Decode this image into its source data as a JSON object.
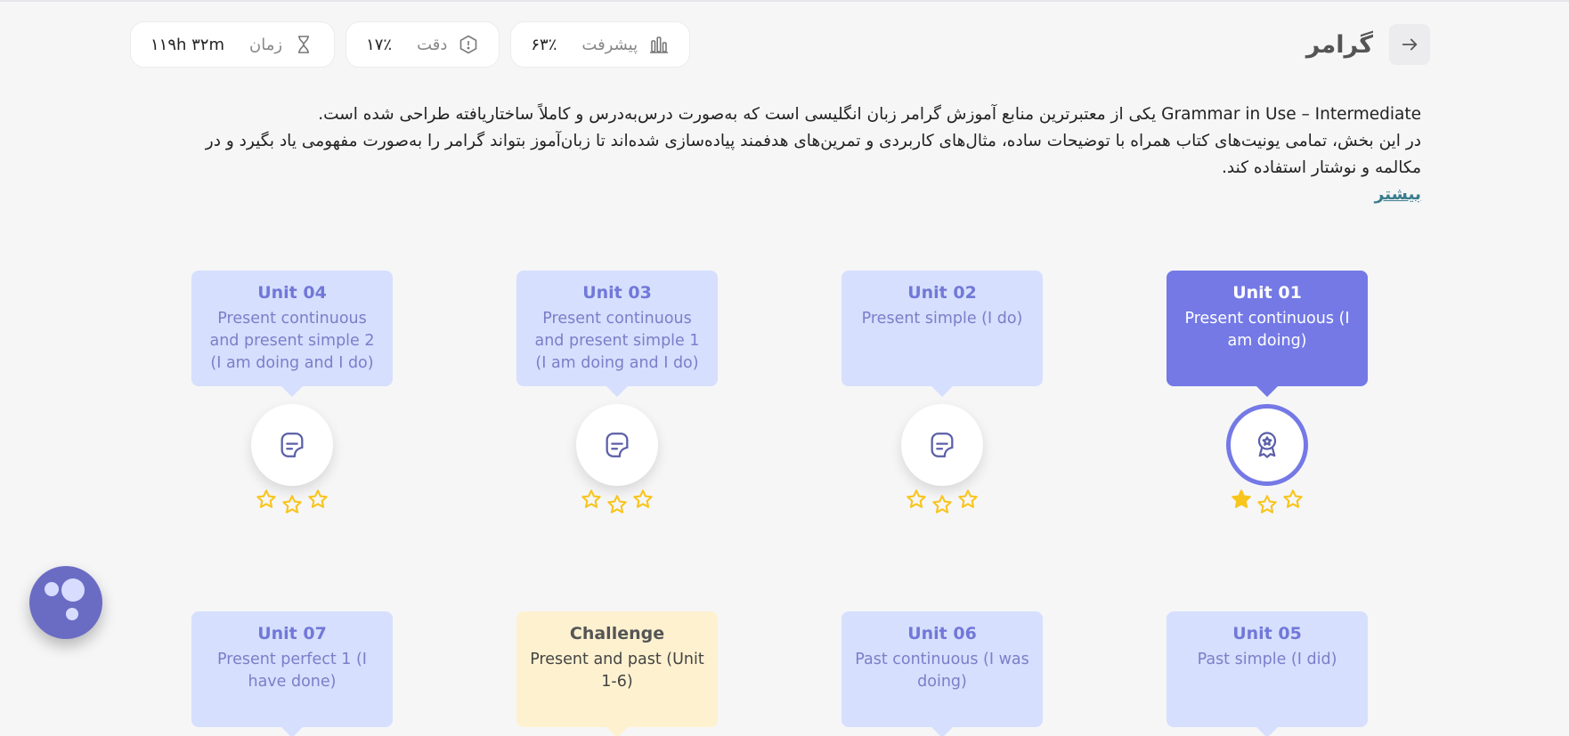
{
  "header": {
    "title": "گرامر",
    "stats": [
      {
        "label": "پیشرفت",
        "value": "۶۳٪",
        "icon": "bar-chart-icon"
      },
      {
        "label": "دقت",
        "value": "۱۷٪",
        "icon": "alert-octagon-icon"
      },
      {
        "label": "زمان",
        "value": "۱۱۹h ۳۲m",
        "icon": "hourglass-icon"
      }
    ]
  },
  "description": {
    "line1": "Grammar in Use – Intermediate یکی از معتبرترین منابع آموزش گرامر زبان انگلیسی است که به‌صورت درس‌به‌درس و کاملاً ساختاریافته طراحی شده است.",
    "line2": "در این بخش، تمامی یونیت‌های کتاب همراه با توضیحات ساده، مثال‌های کاربردی و تمرین‌های هدفمند پیاده‌سازی شده‌اند تا زبان‌آموز بتواند گرامر را به‌صورت مفهومی یاد بگیرد و در مکالمه و نوشتار استفاده کند.",
    "more": "بیشتر"
  },
  "units": [
    {
      "title": "Unit 01",
      "subtitle": "Present continuous (I am doing)"
    },
    {
      "title": "Unit 02",
      "subtitle": "Present simple (I do)"
    },
    {
      "title": "Unit 03",
      "subtitle": "Present continuous and present simple 1 (I am doing and I do)"
    },
    {
      "title": "Unit 04",
      "subtitle": "Present continuous and present simple 2 (I am doing and I do)"
    },
    {
      "title": "Unit 05",
      "subtitle": "Past simple (I did)"
    },
    {
      "title": "Unit 06",
      "subtitle": "Past continuous (I was doing)"
    },
    {
      "title": "Challenge",
      "subtitle": "Present and past (Unit 1-6)"
    },
    {
      "title": "Unit 07",
      "subtitle": "Present perfect 1 (I have done)"
    }
  ],
  "unit_stars": [
    1,
    0,
    0,
    0
  ],
  "colors": {
    "accent": "#7479e6",
    "star": "#f8c51c",
    "card": "#d6dffd",
    "challenge": "#fdf1cf"
  }
}
